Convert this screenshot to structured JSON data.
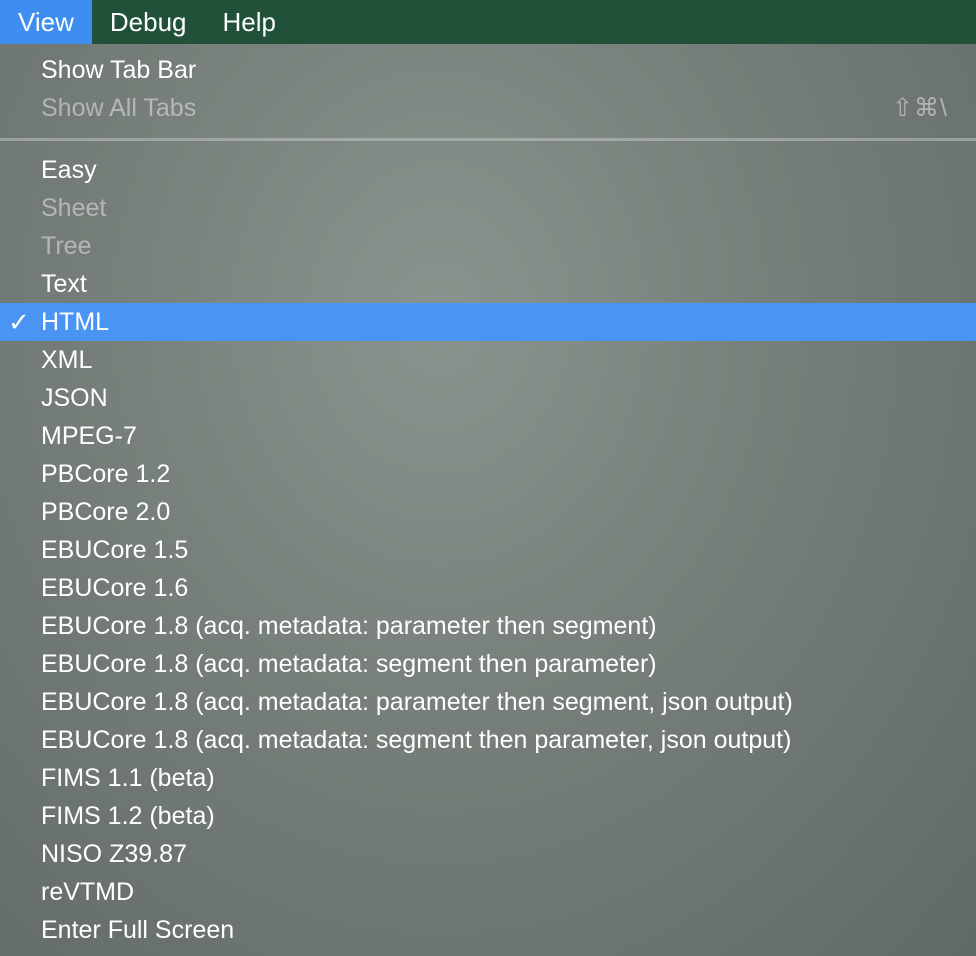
{
  "menubar": {
    "items": [
      "View",
      "Debug",
      "Help"
    ],
    "active": "View"
  },
  "menu": {
    "top_items": [
      {
        "label": "Show Tab Bar",
        "enabled": true
      },
      {
        "label": "Show All Tabs",
        "enabled": false,
        "shortcut": "⇧⌘\\"
      }
    ],
    "view_items": [
      {
        "label": "Easy",
        "enabled": true
      },
      {
        "label": "Sheet",
        "enabled": false
      },
      {
        "label": "Tree",
        "enabled": false
      },
      {
        "label": "Text",
        "enabled": true
      },
      {
        "label": "HTML",
        "enabled": true,
        "checked": true,
        "check_mark": "✓"
      },
      {
        "label": "XML",
        "enabled": true
      },
      {
        "label": "JSON",
        "enabled": true
      },
      {
        "label": "MPEG-7",
        "enabled": true
      },
      {
        "label": "PBCore 1.2",
        "enabled": true
      },
      {
        "label": "PBCore 2.0",
        "enabled": true
      },
      {
        "label": "EBUCore 1.5",
        "enabled": true
      },
      {
        "label": "EBUCore 1.6",
        "enabled": true
      },
      {
        "label": "EBUCore 1.8 (acq. metadata: parameter then segment)",
        "enabled": true
      },
      {
        "label": "EBUCore 1.8 (acq. metadata: segment then parameter)",
        "enabled": true
      },
      {
        "label": "EBUCore 1.8 (acq. metadata: parameter then segment, json output)",
        "enabled": true
      },
      {
        "label": "EBUCore 1.8 (acq. metadata: segment then parameter, json output)",
        "enabled": true
      },
      {
        "label": "FIMS 1.1 (beta)",
        "enabled": true
      },
      {
        "label": "FIMS 1.2 (beta)",
        "enabled": true
      },
      {
        "label": "NISO Z39.87",
        "enabled": true
      },
      {
        "label": "reVTMD",
        "enabled": true
      },
      {
        "label": "Enter Full Screen",
        "enabled": true
      }
    ]
  },
  "colors": {
    "menubar_bg": "#22513a",
    "menubar_active": "#3e8ef1",
    "highlight": "#4a95f3"
  }
}
